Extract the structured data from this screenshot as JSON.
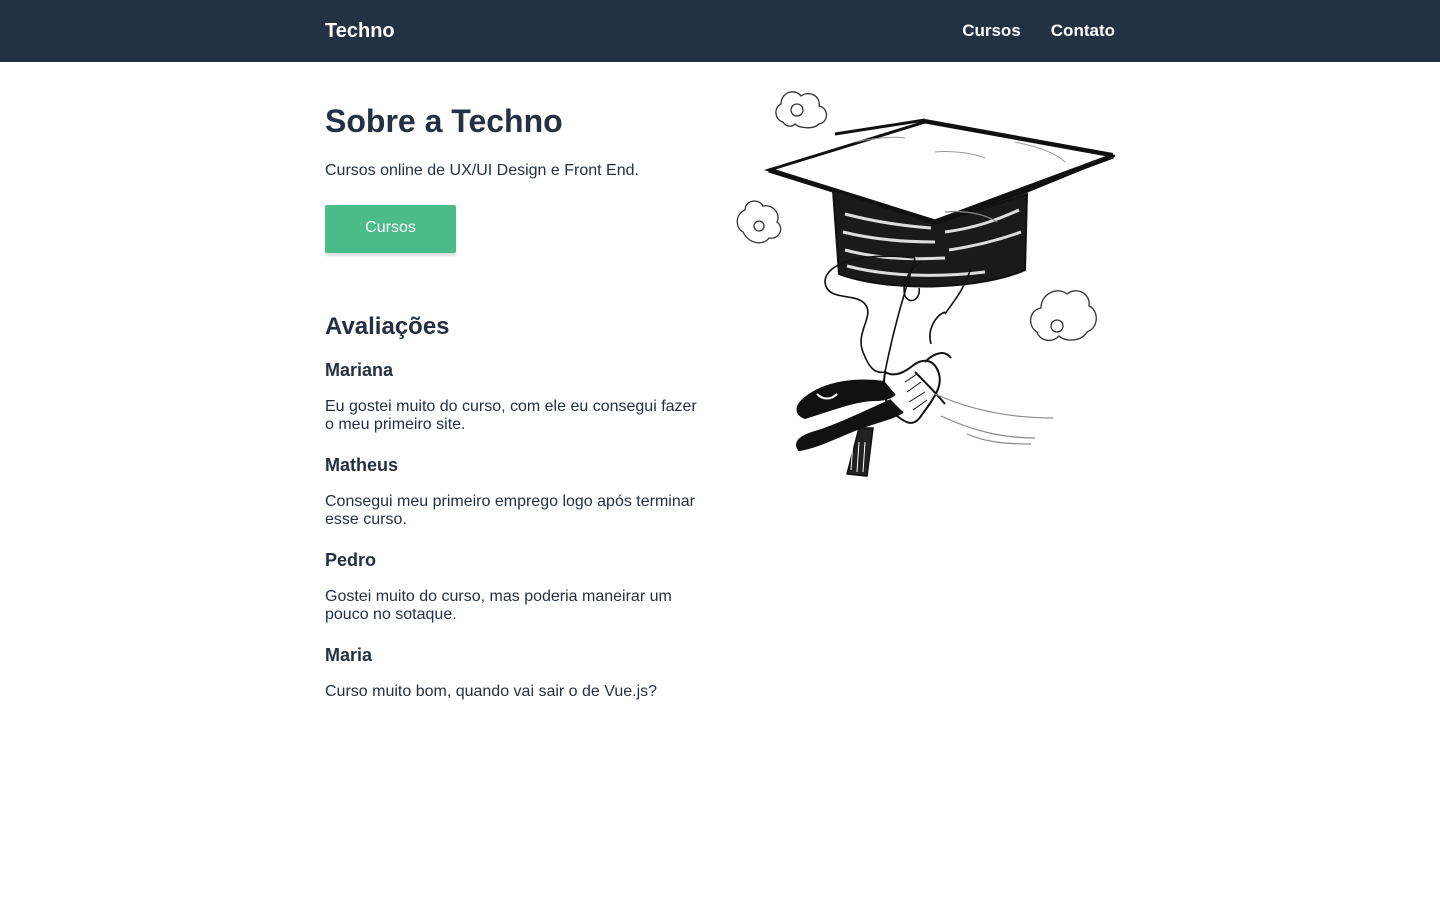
{
  "header": {
    "brand": "Techno",
    "nav": [
      "Cursos",
      "Contato"
    ]
  },
  "about": {
    "title": "Sobre a Techno",
    "subtitle": "Cursos online de UX/UI Design e Front End.",
    "button_label": "Cursos"
  },
  "reviews": {
    "title": "Avaliações",
    "items": [
      {
        "name": "Mariana",
        "text": "Eu gostei muito do curso, com ele eu consegui fazer o meu primeiro site."
      },
      {
        "name": "Matheus",
        "text": "Consegui meu primeiro emprego logo após terminar esse curso."
      },
      {
        "name": "Pedro",
        "text": "Gostei muito do curso, mas poderia maneirar um pouco no sotaque."
      },
      {
        "name": "Maria",
        "text": "Curso muito bom, quando vai sair o de Vue.js?"
      }
    ]
  },
  "colors": {
    "header_bg": "#233142",
    "accent": "#4cbb8a",
    "text": "#233142"
  },
  "icons": {
    "illustration": "graduation-cap-balloon-illustration"
  }
}
